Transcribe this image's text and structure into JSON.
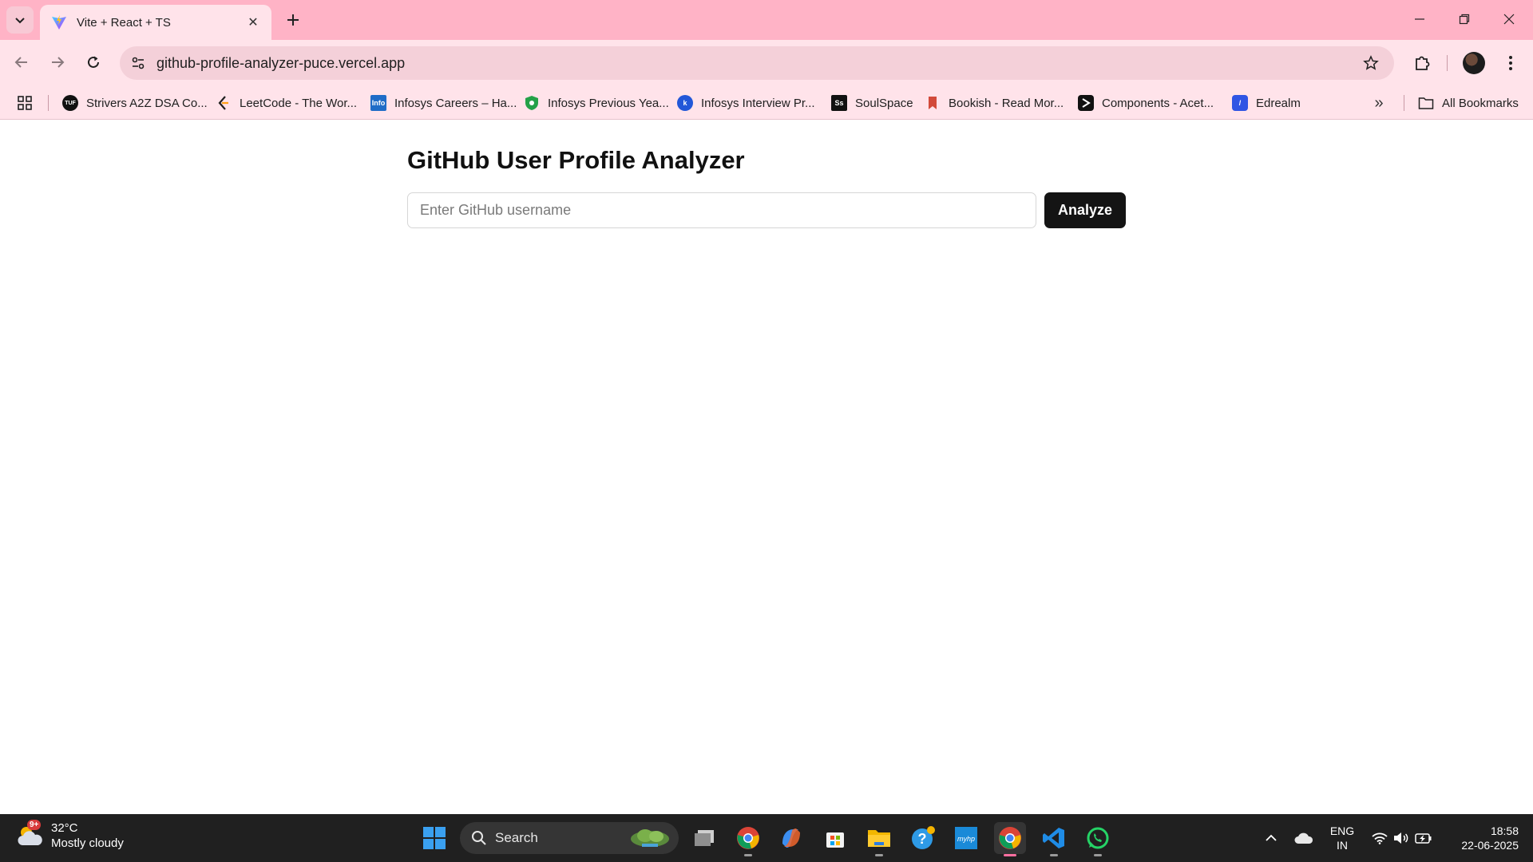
{
  "browser": {
    "tab": {
      "title": "Vite + React + TS"
    },
    "address_bar": {
      "url": "github-profile-analyzer-puce.vercel.app"
    },
    "bookmarks": [
      {
        "label": "Strivers A2Z DSA Co...",
        "icon_text": "TUF",
        "color": "#111111"
      },
      {
        "label": "LeetCode - The Wor...",
        "icon_text": "",
        "color": "#ffa116"
      },
      {
        "label": "Infosys Careers – Ha...",
        "icon_text": "Info",
        "color": "#1f6cc7"
      },
      {
        "label": "Infosys Previous Yea...",
        "icon_text": "",
        "color": "#24a148"
      },
      {
        "label": "Infosys Interview Pr...",
        "icon_text": "",
        "color": "#2257d8"
      },
      {
        "label": "SoulSpace",
        "icon_text": "Ss",
        "color": "#111111"
      },
      {
        "label": "Bookish - Read Mor...",
        "icon_text": "",
        "color": "#d24a3a"
      },
      {
        "label": "Components - Acet...",
        "icon_text": "",
        "color": "#111111"
      },
      {
        "label": "Edrealm",
        "icon_text": "",
        "color": "#2f55e4"
      }
    ],
    "all_bookmarks_label": "All Bookmarks"
  },
  "page": {
    "title": "GitHub User Profile Analyzer",
    "search": {
      "placeholder": "Enter GitHub username",
      "value": ""
    },
    "analyze_label": "Analyze"
  },
  "taskbar": {
    "weather": {
      "temp": "32°C",
      "condition": "Mostly cloudy",
      "badge": "9+"
    },
    "search_label": "Search",
    "language": {
      "line1": "ENG",
      "line2": "IN"
    },
    "clock": {
      "time": "18:58",
      "date": "22-06-2025"
    }
  },
  "colors": {
    "tabbar": "#ffb3c6",
    "toolbar": "#ffe3ea",
    "button": "#141414",
    "taskbar": "#202020"
  }
}
